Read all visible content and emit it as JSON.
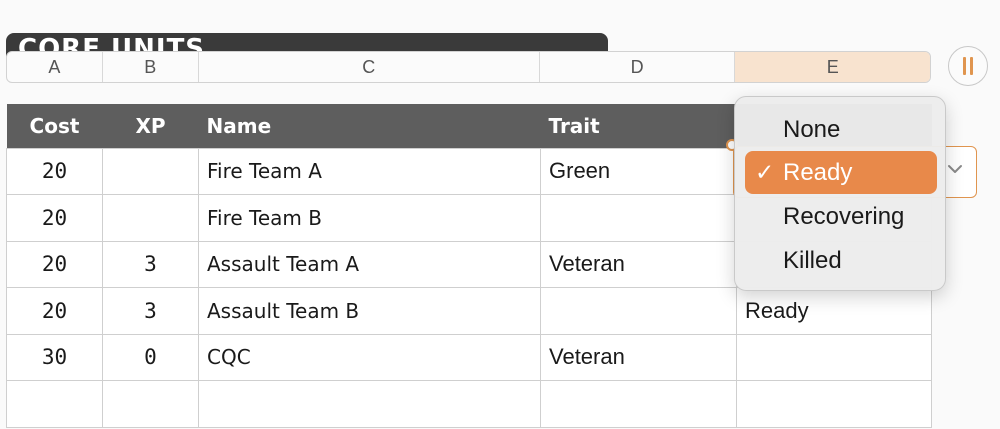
{
  "sheet": {
    "title": "CORE UNITS"
  },
  "columns": [
    "A",
    "B",
    "C",
    "D",
    "E"
  ],
  "table": {
    "headers": [
      "Cost",
      "XP",
      "Name",
      "Trait",
      ""
    ],
    "rows": [
      {
        "cost": "20",
        "xp": "",
        "name": "Fire Team A",
        "trait": "Green",
        "status": ""
      },
      {
        "cost": "20",
        "xp": "",
        "name": "Fire Team B",
        "trait": "",
        "status": ""
      },
      {
        "cost": "20",
        "xp": "3",
        "name": "Assault Team A",
        "trait": "Veteran",
        "status": ""
      },
      {
        "cost": "20",
        "xp": "3",
        "name": "Assault Team B",
        "trait": "",
        "status": "Ready"
      },
      {
        "cost": "30",
        "xp": "0",
        "name": "CQC",
        "trait": "Veteran",
        "status": ""
      },
      {
        "cost": "",
        "xp": "",
        "name": "",
        "trait": "",
        "status": ""
      }
    ]
  },
  "popup_menu": {
    "options": [
      "None",
      "Ready",
      "Recovering",
      "Killed"
    ],
    "selected": "Ready",
    "check_mark": "✓"
  },
  "colors": {
    "accent": "#e8894a",
    "header_bg": "#5e5e5e",
    "title_bg": "#3a3a3a",
    "active_column": "#f8e3cf"
  },
  "icons": [
    "chevron-down-icon",
    "pause-icon",
    "checkmark-icon"
  ]
}
